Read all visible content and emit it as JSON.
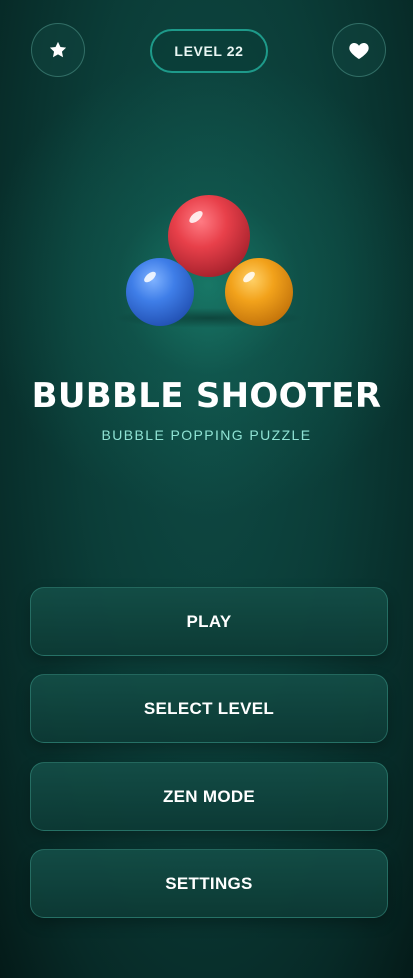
{
  "header": {
    "level_label": "LEVEL 22",
    "left_icon": "star-icon",
    "right_icon": "heart-icon"
  },
  "logo": {
    "bubbles": [
      {
        "color": "red",
        "hex": "#e8404a"
      },
      {
        "color": "blue",
        "hex": "#3f7ee8"
      },
      {
        "color": "orange",
        "hex": "#f2a21b"
      }
    ]
  },
  "title": "BUBBLE SHOOTER",
  "subtitle": "BUBBLE POPPING PUZZLE",
  "menu": {
    "play": "PLAY",
    "select_level": "SELECT LEVEL",
    "zen_mode": "ZEN MODE",
    "settings": "SETTINGS"
  },
  "colors": {
    "background": "#0b3d38",
    "accent": "#1e9a8a",
    "subtitle": "#8fe3d4"
  }
}
